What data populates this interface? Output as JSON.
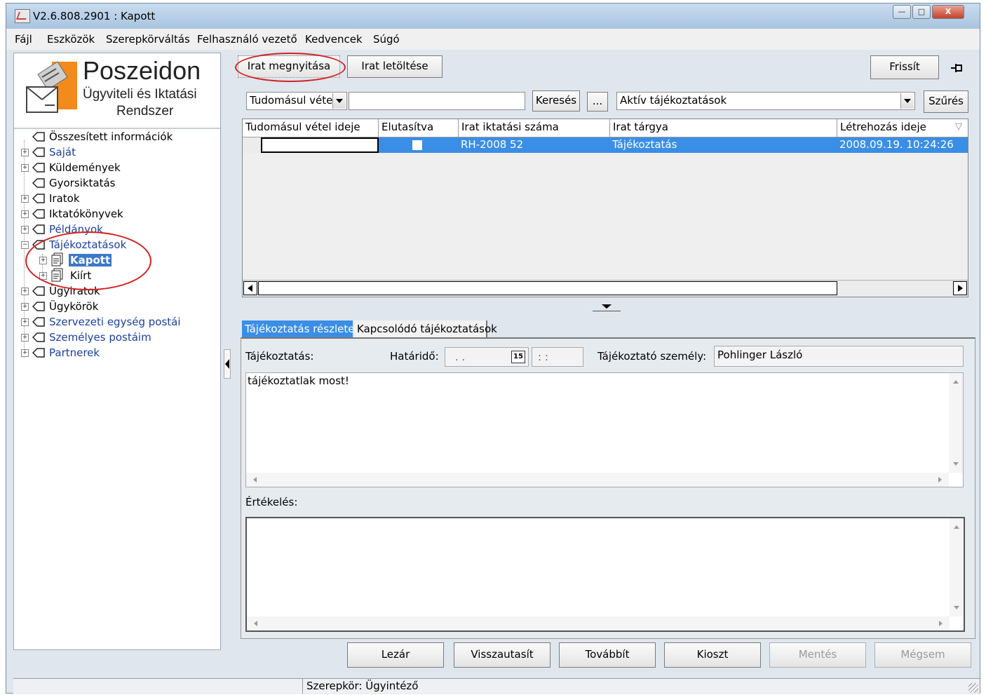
{
  "window": {
    "title": "V2.6.808.2901 : Kapott",
    "controls": {
      "minimize": "—",
      "maximize": "□",
      "close": "X"
    }
  },
  "menu": [
    "Fájl",
    "Eszközök",
    "Szerepkörváltás",
    "Felhasználó vezető",
    "Kedvencek",
    "Súgó"
  ],
  "logo": {
    "name": "Poszeidon",
    "line2": "Ügyviteli és Iktatási",
    "line3": "Rendszer"
  },
  "tree": [
    {
      "label": "Összesített információk",
      "link": false
    },
    {
      "label": "Saját",
      "link": true
    },
    {
      "label": "Küldemények",
      "link": false
    },
    {
      "label": "Gyorsiktatás",
      "link": false
    },
    {
      "label": "Iratok",
      "link": false
    },
    {
      "label": "Iktatókönyvek",
      "link": false
    },
    {
      "label": "Példányok",
      "link": true
    },
    {
      "label": "Tájékoztatások",
      "link": true
    },
    {
      "label": "Kapott",
      "selected": true
    },
    {
      "label": "Kiírt",
      "link": false
    },
    {
      "label": "Ügyiratok",
      "link": false
    },
    {
      "label": "Ügykörök",
      "link": false
    },
    {
      "label": "Szervezeti egység postái",
      "link": true
    },
    {
      "label": "Személyes postáim",
      "link": true
    },
    {
      "label": "Partnerek",
      "link": true
    }
  ],
  "toolbar": {
    "open_doc": "Irat megnyitása",
    "download_doc": "Irat letöltése",
    "refresh": "Frissít",
    "pin_icon": "pin-icon"
  },
  "search": {
    "field_combo": "Tudomásul vétel i",
    "query": "",
    "search_btn": "Keresés",
    "ellipsis_btn": "...",
    "filter_combo": "Aktív tájékoztatások",
    "filter_btn": "Szűrés"
  },
  "grid": {
    "columns": [
      "Tudomásul vétel ideje",
      "Elutasítva",
      "Irat iktatási száma",
      "Irat tárgya",
      "Létrehozás ideje"
    ],
    "rows": [
      {
        "ack_time": "",
        "rejected": false,
        "reg_number": "RH-2008 52",
        "subject": "Tájékoztatás",
        "created": "2008.09.19. 10:24:26"
      }
    ]
  },
  "tabs": [
    "Tájékoztatás részletei",
    "Kapcsolódó tájékoztatások"
  ],
  "detail": {
    "info_label": "Tájékoztatás:",
    "deadline_label": "Határidő:",
    "deadline_date": " .  .",
    "deadline_time": " :  :",
    "calendar_icon": "15",
    "person_label": "Tájékoztató személy:",
    "person_value": "Pohlinger László",
    "info_text": "tájékoztatlak most!",
    "evaluation_label": "Értékelés:",
    "evaluation_text": ""
  },
  "actions": [
    "Lezár",
    "Visszautasít",
    "Továbbít",
    "Kioszt",
    "Mentés",
    "Mégsem"
  ],
  "status": {
    "role": "Szerepkör: Ügyintéző"
  },
  "colors": {
    "selection": "#3a8ee6",
    "tree_link": "#1a3fa0",
    "highlight_circle": "#d42222"
  }
}
